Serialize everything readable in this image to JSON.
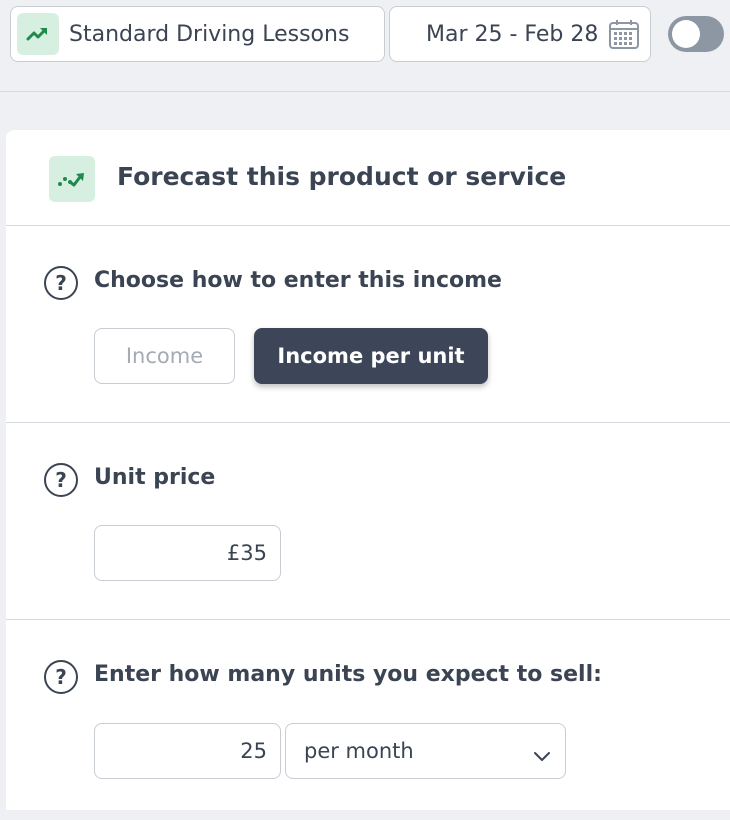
{
  "topbar": {
    "product": {
      "label": "Standard Driving Lessons",
      "icon": "trending-up-icon"
    },
    "date_range": {
      "label": "Mar 25 - Feb 28",
      "icon": "calendar-icon"
    },
    "toggle": {
      "state": "off"
    }
  },
  "card": {
    "header": {
      "title": "Forecast this product or service",
      "icon": "trend-forecast-icon"
    },
    "entry_method": {
      "help_symbol": "?",
      "label": "Choose how to enter this income",
      "options": [
        {
          "label": "Income",
          "selected": false
        },
        {
          "label": "Income per unit",
          "selected": true
        }
      ]
    },
    "unit_price": {
      "help_symbol": "?",
      "label": "Unit price",
      "value": "£35"
    },
    "units": {
      "help_symbol": "?",
      "label": "Enter how many units you expect to sell:",
      "value": "25",
      "period": "per month"
    }
  },
  "colors": {
    "background": "#eef0f3",
    "card": "#ffffff",
    "accent_green": "#1f8a4c",
    "badge_green": "#d6efe0",
    "dark_button": "#3d4658",
    "text": "#3b4453",
    "muted_text": "#a4abb5",
    "border": "#c8cdd4",
    "toggle_off": "#8d96a3"
  }
}
